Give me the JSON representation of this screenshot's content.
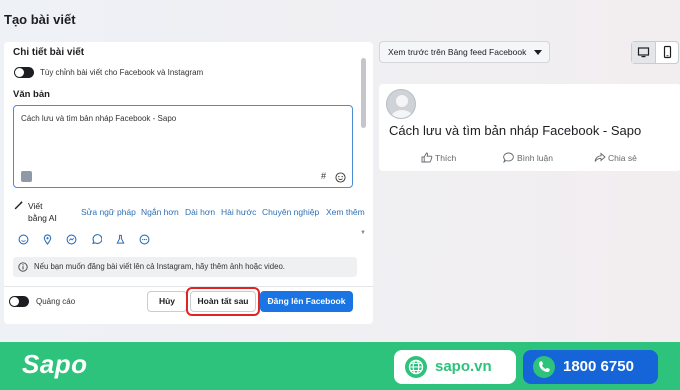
{
  "page": {
    "title": "Tạo bài viết"
  },
  "details": {
    "section_title": "Chi tiết bài viết",
    "customize_label": "Tùy chỉnh bài viết cho Facebook và Instagram"
  },
  "composer": {
    "heading": "Văn bản",
    "text_value": "Cách lưu và tìm bản nháp Facebook - Sapo",
    "hashtag_symbol": "#"
  },
  "ai_tools": {
    "label": "Viết bằng AI",
    "actions": [
      "Sửa ngữ pháp",
      "Ngắn hơn",
      "Dài hơn",
      "Hài hước",
      "Chuyên nghiệp",
      "Xem thêm"
    ]
  },
  "attachments": {
    "icons": [
      "emoji-icon",
      "location-icon",
      "messenger-icon",
      "whatsapp-icon",
      "lab-icon",
      "more-icon"
    ]
  },
  "notice": {
    "text": "Nếu bạn muốn đăng bài viết lên cả Instagram, hãy thêm ảnh hoặc video."
  },
  "footer": {
    "ads_label": "Quảng cáo",
    "cancel_label": "Hủy",
    "save_later_label": "Hoàn tất sau",
    "publish_label": "Đăng lên Facebook"
  },
  "preview": {
    "select_label": "Xem trước trên Bảng feed Facebook",
    "post_text": "Cách lưu và tìm bản nháp Facebook - Sapo",
    "actions": {
      "like": "Thích",
      "comment": "Bình luận",
      "share": "Chia sẻ"
    }
  },
  "banner": {
    "logo_text": "Sapo",
    "website": "sapo.vn",
    "phone": "1800 6750"
  },
  "colors": {
    "primary": "#1b74e4",
    "highlight": "#e02424",
    "brand_green": "#2ec37c",
    "phone_pill": "#1565d8"
  }
}
